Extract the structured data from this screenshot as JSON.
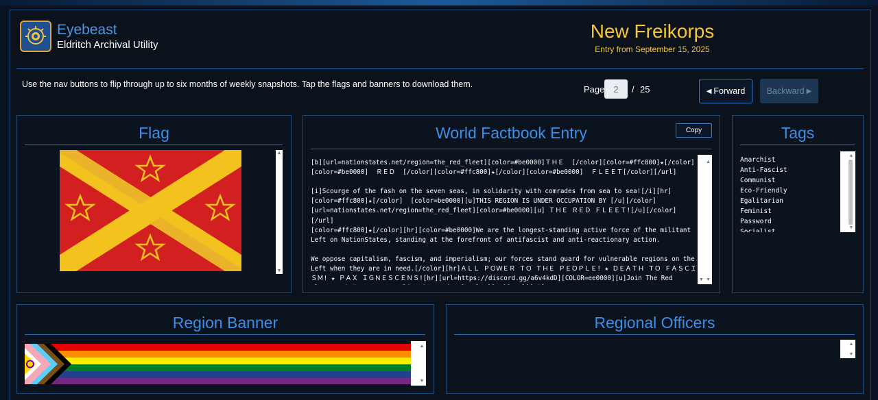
{
  "app": {
    "title": "Eyebeast",
    "subtitle": "Eldritch Archival Utility",
    "logo_icon": "eyebeast-logo-icon"
  },
  "region": {
    "name": "New Freikorps",
    "entry_date": "Entry from September 15, 2025"
  },
  "instructions": "Use the nav buttons to flip through up to six months of weekly snapshots. Tap the flags and banners to download them.",
  "pagination": {
    "label": "Page",
    "current": "2",
    "separator": "/",
    "total": "25",
    "forward_label": "Forward",
    "backward_label": "Backward",
    "forward_icon": "triangle-left-icon",
    "backward_icon": "triangle-right-icon"
  },
  "panels": {
    "flag": {
      "title": "Flag"
    },
    "factbook": {
      "title": "World Factbook Entry",
      "copy_label": "Copy",
      "text": "[b][url=nationstates.net/region=the_red_fleet][color=#be0000]ＴＨＥ  [/color][color=#ffc800]★[/color]\n[color=#be0000]  ＲＥＤ  [/color][color=#ffc800]★[/color][color=#be0000]  ＦＬＥＥＴ[/color][/url]\n\n[i]Scourge of the fash on the seven seas, in solidarity with comrades from sea to sea![/i][hr]\n[color=#ffc800]★[/color]  [color=be0000][u]THIS REGION IS UNDER OCCUPATION BY [/u][/color]\n[url=nationstates.net/region=the_red_fleet][color=#be0000][u] ＴＨＥ ＲＥＤ ＦＬＥＥＴ![/u][/color][/url]\n[color=#ffc800]★[/color][hr][color=#be0000]We are the longest-standing active force of the militant Left on NationStates, standing at the forefront of antifascist and anti-reactionary action.\n\nWe oppose capitalism, fascism, and imperialism; our forces stand guard for vulnerable regions on the Left when they are in need.[/color][hr]ＡＬＬ ＰＯＷＥＲ ＴＯ ＴＨＥ ＰＥＯＰＬＥ! ★ ＤＥＡＴＨ ＴＯ ＦＡＳＣＩＳＭ! ★ ＰＡＸ ＩＧＮＥＳＣＥＮＳ![hr][url=https://discord.gg/a6v4kdD][COLOR=ee0000][u]Join The Red Fleet: Submit a Rate Application today![/color][/u][/url][/b]"
    },
    "tags": {
      "title": "Tags",
      "items": [
        "Anarchist",
        "Anti-Fascist",
        "Communist",
        "Eco-Friendly",
        "Egalitarian",
        "Feminist",
        "Password",
        "Socialist"
      ]
    },
    "banner": {
      "title": "Region Banner"
    },
    "officers": {
      "title": "Regional Officers"
    }
  },
  "colors": {
    "accent_blue": "#3d8ee6",
    "gold": "#f6c634",
    "flag_red": "#d21f1f",
    "flag_gold": "#f4c21f"
  }
}
